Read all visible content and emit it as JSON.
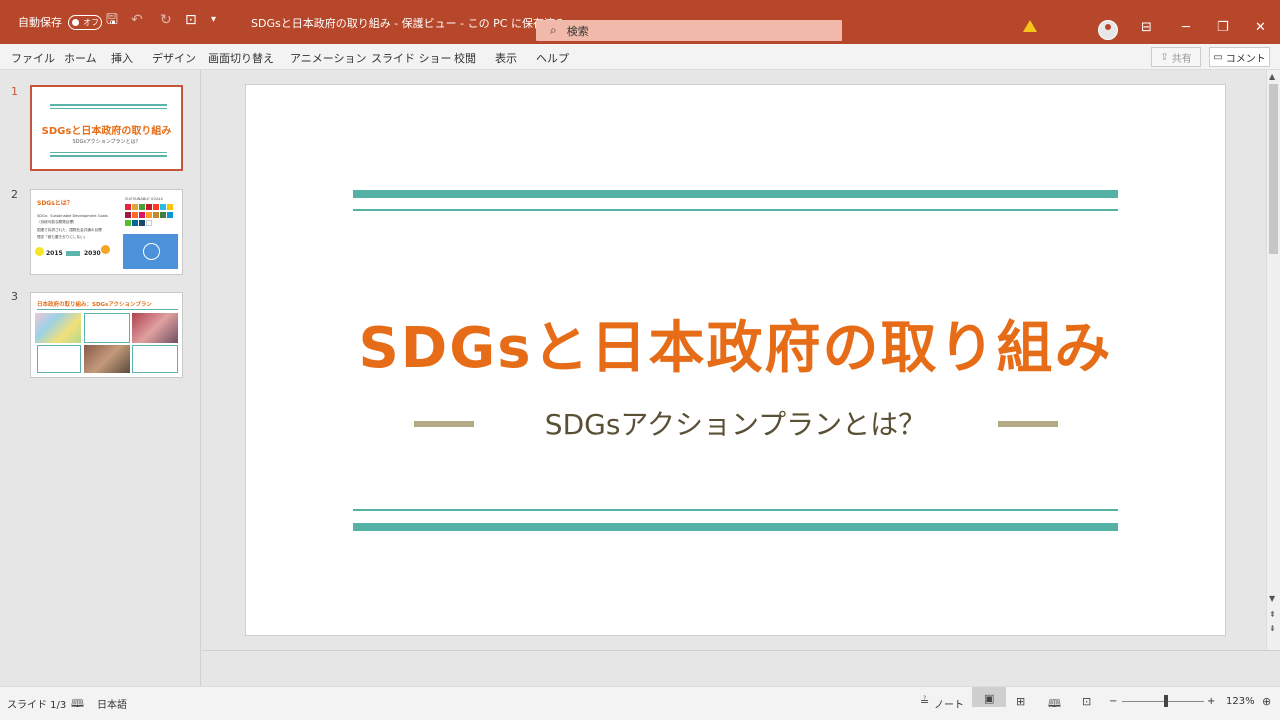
{
  "titlebar": {
    "autosave_label": "自動保存",
    "autosave_state": "オフ",
    "doc_title": "SDGsと日本政府の取り組み  -  保護ビュー  -  この PC に保存済み",
    "search_placeholder": "検索"
  },
  "tabs": [
    "ファイル",
    "ホーム",
    "挿入",
    "デザイン",
    "画面切り替え",
    "アニメーション",
    "スライド ショー",
    "校閲",
    "表示",
    "ヘルプ"
  ],
  "share_label": "共有",
  "comment_label": "コメント",
  "thumbnails": {
    "numbers": [
      "1",
      "2",
      "3"
    ],
    "t1_title": "SDGsと日本政府の取り組み",
    "t1_sub": "SDGsアクションプランとは？",
    "t2_title": "SDGsとは？",
    "t2_lines": [
      "SDGs：Sustainable Development Goals",
      "（持続可能な開発目標）",
      "国連で採択された、国際社会共通の目標",
      "理念「誰も置き去りにしない」"
    ],
    "t2_goals": "SUSTAINABLE GOALS",
    "t2_year_from": "2015",
    "t2_year_to": "2030",
    "t3_title": "日本政府の取り組み：SDGsアクションプラン"
  },
  "slide": {
    "title": "SDGsと日本政府の取り組み",
    "subtitle": "SDGsアクションプランとは？",
    "colors": {
      "title": "#e66c17",
      "line": "#53b1a6",
      "dash": "#b4a888"
    }
  },
  "status": {
    "slide_indicator": "スライド 1/3",
    "language": "日本語",
    "notes_label": "ノート",
    "zoom": "123%"
  }
}
